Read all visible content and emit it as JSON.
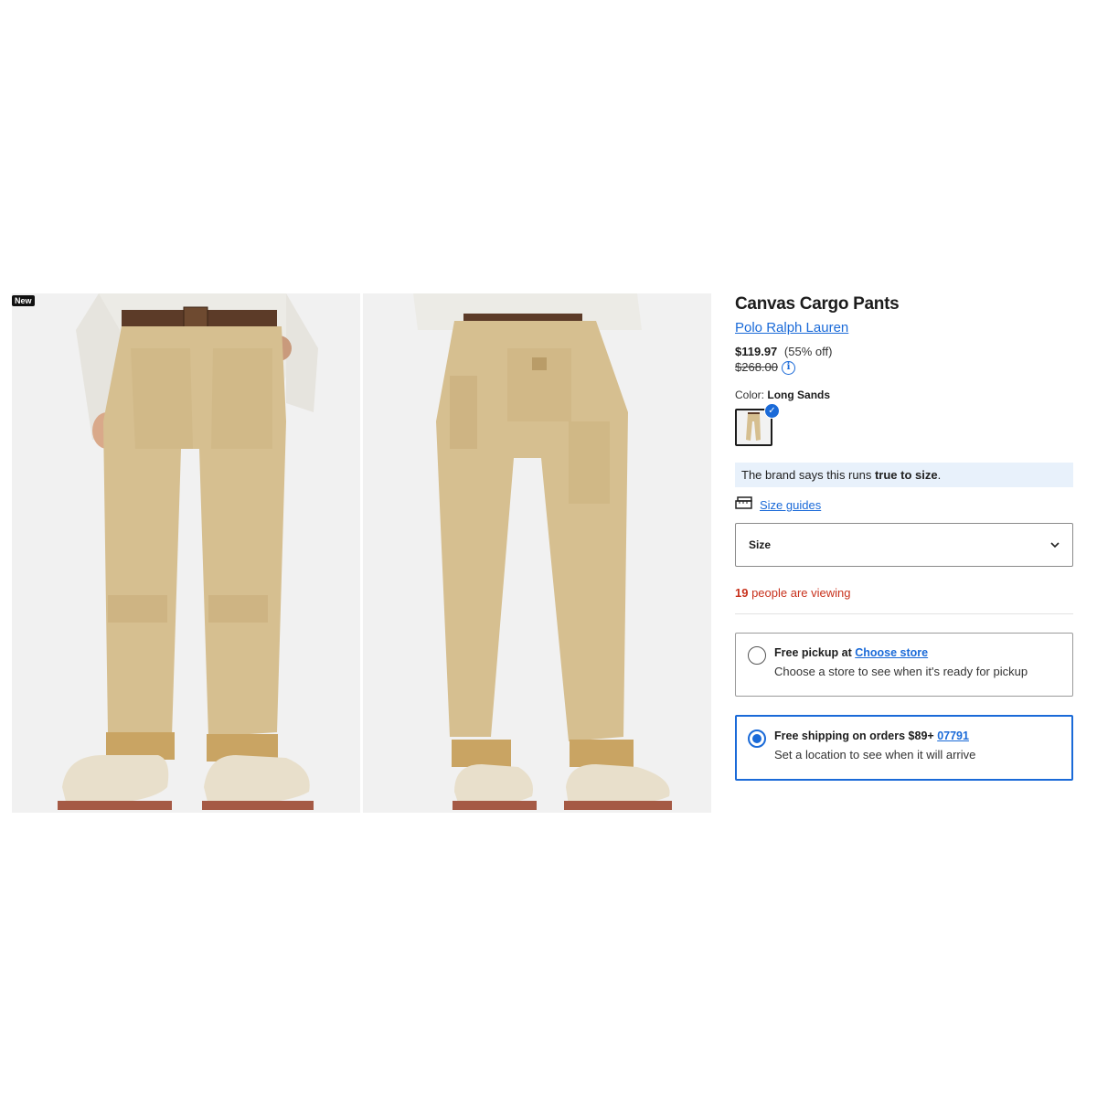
{
  "badge": "New",
  "product": {
    "title": "Canvas Cargo Pants",
    "brand": "Polo Ralph Lauren",
    "sale_price": "$119.97",
    "discount": "(55% off)",
    "original_price": "$268.00",
    "color_label": "Color:",
    "color_value": "Long Sands"
  },
  "fit": {
    "prefix": "The brand says this runs ",
    "emphasis": "true to size",
    "suffix": "."
  },
  "size": {
    "guides_label": "Size guides",
    "select_label": "Size"
  },
  "viewing": {
    "count": "19",
    "text": " people are viewing"
  },
  "delivery": {
    "pickup": {
      "title": "Free pickup at ",
      "link": "Choose store",
      "subtitle": "Choose a store to see when it's ready for pickup",
      "selected": false
    },
    "shipping": {
      "title": "Free shipping on orders $89+ ",
      "link": "07791",
      "subtitle": "Set a location to see when it will arrive",
      "selected": true
    }
  },
  "colors": {
    "accent": "#1a6ad8",
    "alert": "#c8321d",
    "pants": "#d6bf90",
    "cuff": "#c9a463"
  }
}
